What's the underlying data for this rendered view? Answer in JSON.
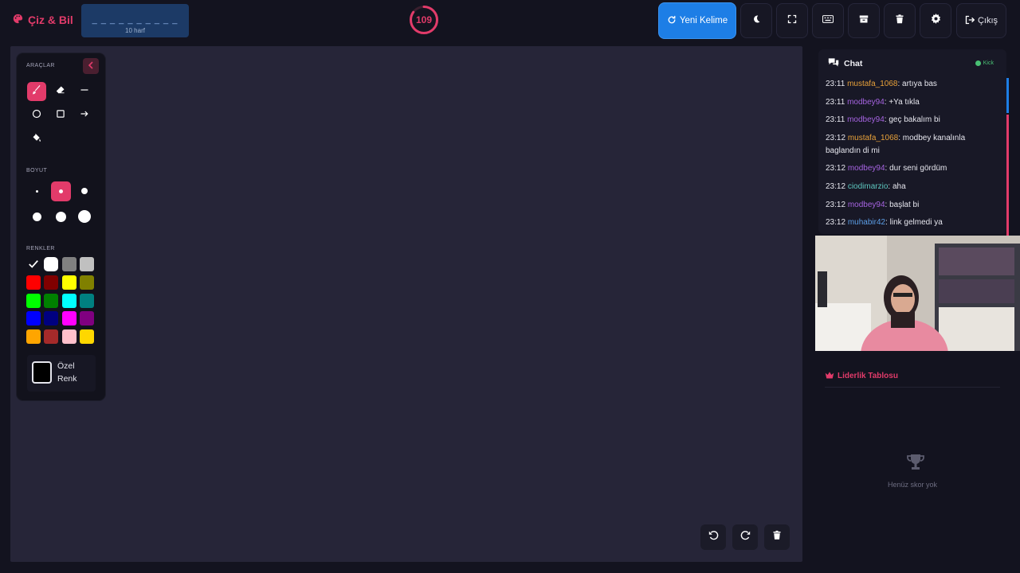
{
  "brand": {
    "name": "Çiz & Bil"
  },
  "word": {
    "pattern": "_ _ _ _ _ _ _ _ _ _",
    "count_label": "10 harf"
  },
  "timer": {
    "value": "109",
    "fraction_remaining": 0.85
  },
  "toolbar": {
    "new_word_label": "Yeni Kelime",
    "exit_label": "Çıkış"
  },
  "tools_panel": {
    "tools_title": "ARAÇLAR",
    "size_title": "BOYUT",
    "colors_title": "RENKLER",
    "custom_color_label": "Özel Renk",
    "colors": [
      "#000000",
      "#ffffff",
      "#808080",
      "#c0c0c0",
      "#ff0000",
      "#800000",
      "#ffff00",
      "#808000",
      "#00ff00",
      "#008000",
      "#00ffff",
      "#008080",
      "#0000ff",
      "#000080",
      "#ff00ff",
      "#800080",
      "#ffa500",
      "#a52a2a",
      "#ffc0cb",
      "#ffd700"
    ]
  },
  "chat": {
    "title": "Chat",
    "platform": "Kick",
    "messages": [
      {
        "time": "23:11",
        "user": "mustafa_1068",
        "color": "#e8a13a",
        "text": ": artıya bas"
      },
      {
        "time": "23:11",
        "user": "modbey94",
        "color": "#a563e0",
        "text": ": +Ya tıkla"
      },
      {
        "time": "23:11",
        "user": "modbey94",
        "color": "#a563e0",
        "text": ": geç bakalım bi"
      },
      {
        "time": "23:12",
        "user": "mustafa_1068",
        "color": "#e8a13a",
        "text": ": modbey kanalınla baglandın di mi"
      },
      {
        "time": "23:12",
        "user": "modbey94",
        "color": "#a563e0",
        "text": ": dur seni gördüm"
      },
      {
        "time": "23:12",
        "user": "ciodimarzio",
        "color": "#5ec8c0",
        "text": ": aha"
      },
      {
        "time": "23:12",
        "user": "modbey94",
        "color": "#a563e0",
        "text": ": başlat bi"
      },
      {
        "time": "23:12",
        "user": "muhabir42",
        "color": "#5c9ee6",
        "text": ": link gelmedi ya"
      }
    ]
  },
  "leaderboard": {
    "title": "Liderlik Tablosu",
    "empty_text": "Henüz skor yok"
  },
  "colors": {
    "accent": "#e23b6a",
    "primary": "#1d7ee6",
    "canvas": "#262538",
    "background": "#13131f"
  }
}
